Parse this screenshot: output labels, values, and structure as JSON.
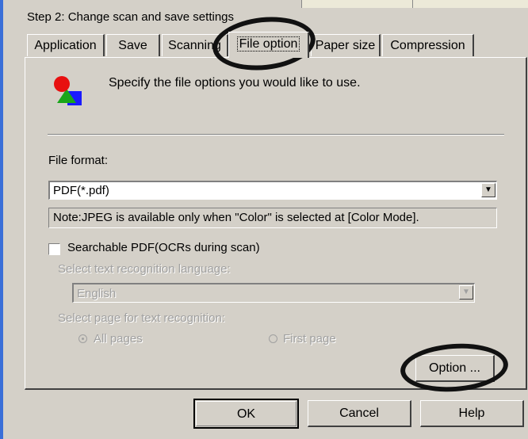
{
  "header": {
    "step_label": "Step 2: Change scan and save settings"
  },
  "tabs": [
    {
      "label": "Application"
    },
    {
      "label": "Save"
    },
    {
      "label": "Scanning"
    },
    {
      "label": "File option"
    },
    {
      "label": "Paper size"
    },
    {
      "label": "Compression"
    }
  ],
  "active_tab": "File option",
  "panel": {
    "description": "Specify the file options you would like to use.",
    "file_format_label": "File format:",
    "file_format_value": "PDF(*.pdf)",
    "note": "Note:JPEG is available only when \"Color\" is selected at [Color Mode].",
    "searchable_pdf_label": "Searchable PDF(OCRs during scan)",
    "searchable_pdf_checked": false,
    "language_label": "Select text recognition language:",
    "language_value": "English",
    "page_label": "Select page for text recognition:",
    "radio_all_pages": "All pages",
    "radio_first_page": "First page",
    "option_button": "Option ..."
  },
  "footer": {
    "ok": "OK",
    "cancel": "Cancel",
    "help": "Help"
  },
  "colors": {
    "dialog_bg": "#d4d0c8",
    "annotation": "#111111",
    "window_edge": "#3a6fd8"
  }
}
